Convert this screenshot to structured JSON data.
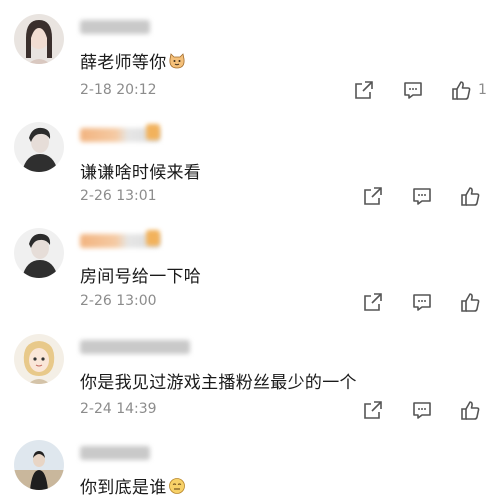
{
  "comments": [
    {
      "text": "薛老师等你",
      "time": "2-18 20:12",
      "likes": "1",
      "emoji": "cat-face-icon"
    },
    {
      "text": "谦谦啥时候来看",
      "time": "2-26 13:01"
    },
    {
      "text": "房间号给一下哈",
      "time": "2-26 13:00"
    },
    {
      "text": "你是我见过游戏主播粉丝最少的一个",
      "time": "2-24 14:39"
    },
    {
      "text": "你到底是谁",
      "emoji": "face-icon"
    }
  ],
  "colors": {
    "text": "#1a1a1a",
    "meta": "#8c8c8c",
    "icon": "#555555"
  }
}
